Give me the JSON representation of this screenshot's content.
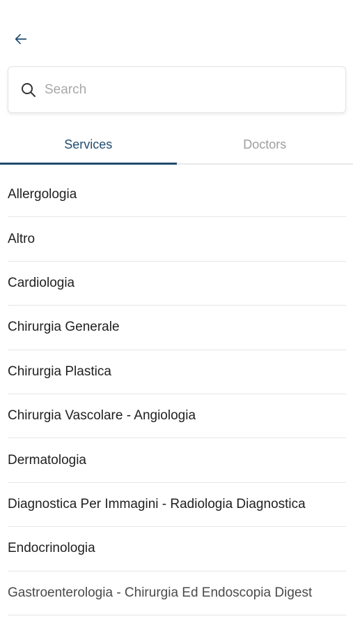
{
  "header": {
    "back_icon": "arrow-left-icon"
  },
  "search": {
    "placeholder": "Search",
    "icon": "search-icon"
  },
  "tabs": [
    {
      "label": "Services",
      "active": true
    },
    {
      "label": "Doctors",
      "active": false
    }
  ],
  "services": [
    {
      "label": "Allergologia"
    },
    {
      "label": "Altro"
    },
    {
      "label": "Cardiologia"
    },
    {
      "label": "Chirurgia Generale"
    },
    {
      "label": "Chirurgia Plastica"
    },
    {
      "label": "Chirurgia Vascolare - Angiologia"
    },
    {
      "label": "Dermatologia"
    },
    {
      "label": "Diagnostica Per Immagini - Radiologia Diagnostica"
    },
    {
      "label": "Endocrinologia"
    },
    {
      "label": "Gastroenterologia - Chirurgia Ed Endoscopia Digest"
    }
  ],
  "colors": {
    "accent": "#1f4b6e",
    "inactive_tab": "#9e9e9e",
    "divider": "#e6e6e6"
  }
}
